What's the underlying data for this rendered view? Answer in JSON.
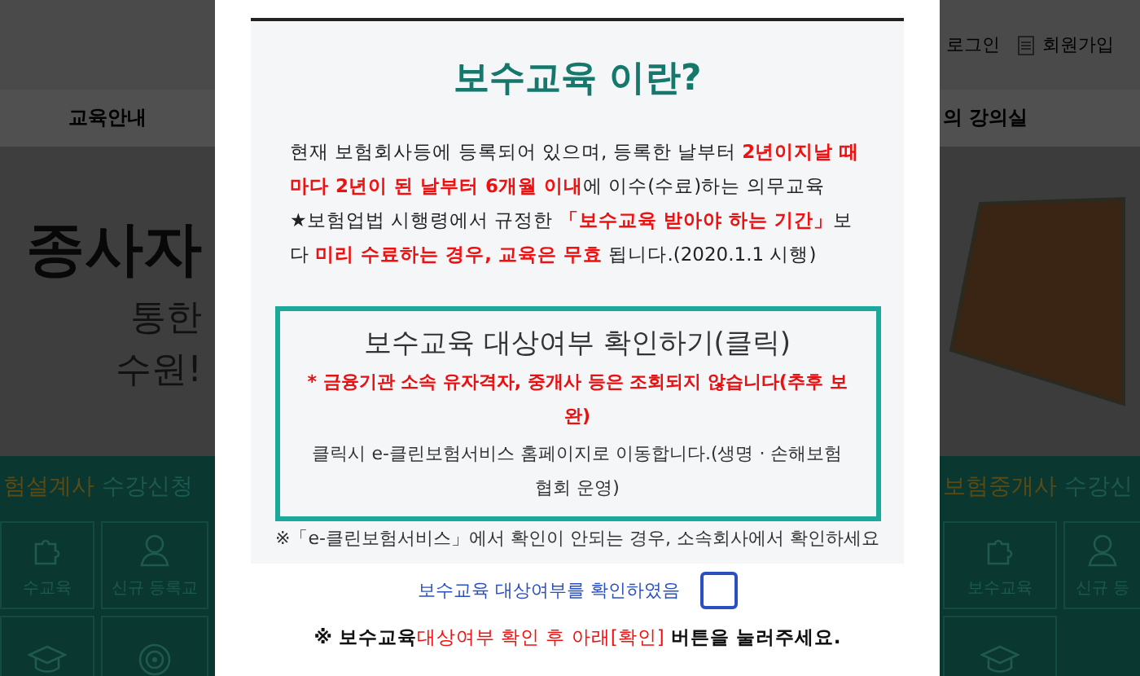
{
  "background_page": {
    "left": {
      "nav_item": "교육안내",
      "hero_lines": [
        "종사자",
        "통한",
        "수원!"
      ],
      "section_title": {
        "highlight": "험설계사",
        "rest": "수강신청"
      },
      "tiles": [
        {
          "label": "수교육",
          "kind": "puzzle"
        },
        {
          "label": "신규 등록교",
          "kind": "person"
        },
        {
          "kind": "cap"
        },
        {
          "kind": "target"
        }
      ]
    },
    "right": {
      "header_links": [
        {
          "label": "로그인",
          "kind": "none"
        },
        {
          "label": "회원가입",
          "kind": "doc"
        }
      ],
      "nav_item": "의 강의실",
      "section_title": {
        "highlight": "보험중개사",
        "rest": "수강신"
      },
      "tiles": [
        {
          "label": "보수교육",
          "kind": "puzzle"
        },
        {
          "label": "신규 등",
          "kind": "person"
        },
        {
          "kind": "cap"
        }
      ]
    }
  },
  "modal": {
    "title": "보수교육 이란?",
    "paragraphs": [
      [
        {
          "text": "현재 보험회사등에 등록되어 있으며, 등록한 날부터 ",
          "red": false
        },
        {
          "text": "2년이지날 때마다 2년이 된 날부터 6개월 이내",
          "red": true
        },
        {
          "text": "에 이수(수료)하는 의무교육",
          "red": false
        }
      ],
      [
        {
          "text": "★보험업법 시행령에서 규정한 ",
          "red": false
        },
        {
          "text": "「보수교육 받아야 하는 기간」",
          "red": true
        },
        {
          "text": "보다 ",
          "red": false
        },
        {
          "text": "미리 수료하는 경우, 교육은 무효",
          "red": true
        },
        {
          "text": " 됩니다.(2020.1.1 시행)",
          "red": false
        }
      ]
    ],
    "check_box": {
      "title": "보수교육 대상여부 확인하기(클릭)",
      "warning": "* 금융기관 소속 유자격자, 중개사 등은 조회되지 않습니다(추후 보완)",
      "info": "클릭시 e-클린보험서비스 홈페이지로 이동합니다.(생명 · 손해보험협회 운영)"
    },
    "note": "※「e-클린보험서비스」에서 확인이 안되는 경우, 소속회사에서 확인하세요",
    "confirm": {
      "label": "보수교육 대상여부를 확인하였음",
      "checked": false
    },
    "instruction": [
      {
        "text": "※ 보수교육",
        "red": false
      },
      {
        "text": "대상여부 확인 후 아래[확인]",
        "red": true
      },
      {
        "text": " 버튼을 눌러주세요.",
        "red": false
      }
    ]
  }
}
